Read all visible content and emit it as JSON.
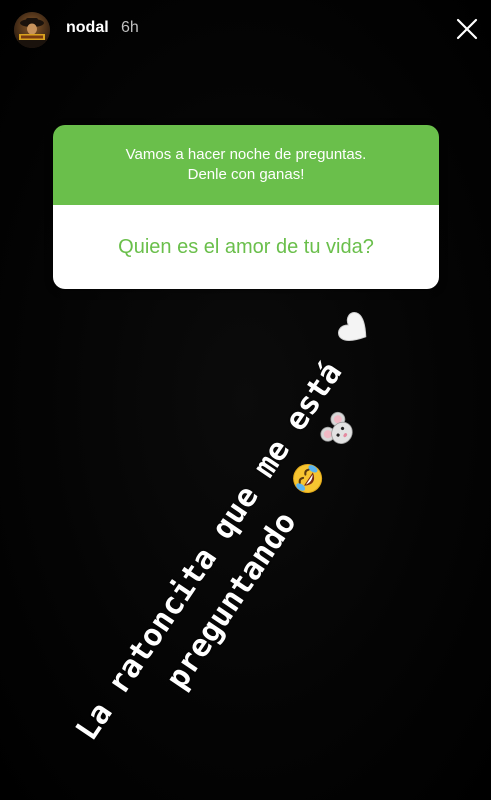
{
  "header": {
    "username": "nodal",
    "time_ago": "6h",
    "close_icon": "close-icon"
  },
  "question_sticker": {
    "prompt_line1": "Vamos a hacer noche de preguntas.",
    "prompt_line2": "Denle con ganas!",
    "answer": "Quien es el amor de tu vida?",
    "accent_color": "#6abf4b"
  },
  "caption": {
    "line1": "La ratoncita que me está",
    "line2": "preguntando",
    "emojis": [
      "laughing-crying-emoji",
      "mouse-face-emoji",
      "white-heart-emoji"
    ]
  },
  "colors": {
    "background": "#000000",
    "text": "#ffffff"
  }
}
